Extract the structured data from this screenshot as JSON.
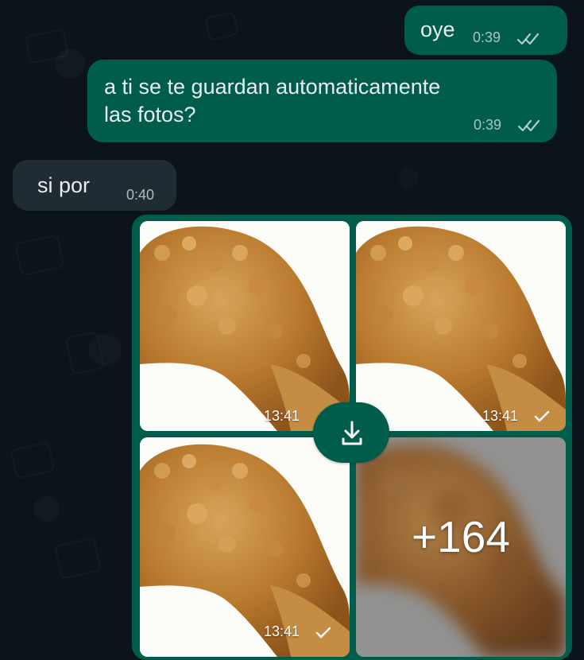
{
  "chat": {
    "messages": [
      {
        "side": "outgoing",
        "text": "oye",
        "time": "0:39",
        "status": "read-double-check-icon"
      },
      {
        "side": "outgoing",
        "text_lines": [
          "a ti se te guardan automaticamente",
          "las fotos?"
        ],
        "time": "0:39",
        "status": "read-double-check-icon"
      },
      {
        "side": "incoming",
        "text": "si por",
        "time": "0:40"
      }
    ],
    "media_group": {
      "photos": [
        {
          "time": "13:41",
          "status": "sent-check-icon"
        },
        {
          "time": "13:41",
          "status": "sent-check-icon"
        },
        {
          "time": "13:41",
          "status": "sent-check-icon"
        }
      ],
      "overflow_count": "+164",
      "download_icon": "download-icon"
    }
  },
  "colors": {
    "background": "#0b141a",
    "outgoing_bubble": "#005c4b",
    "incoming_bubble": "#202c33",
    "text": "#e9edef"
  }
}
